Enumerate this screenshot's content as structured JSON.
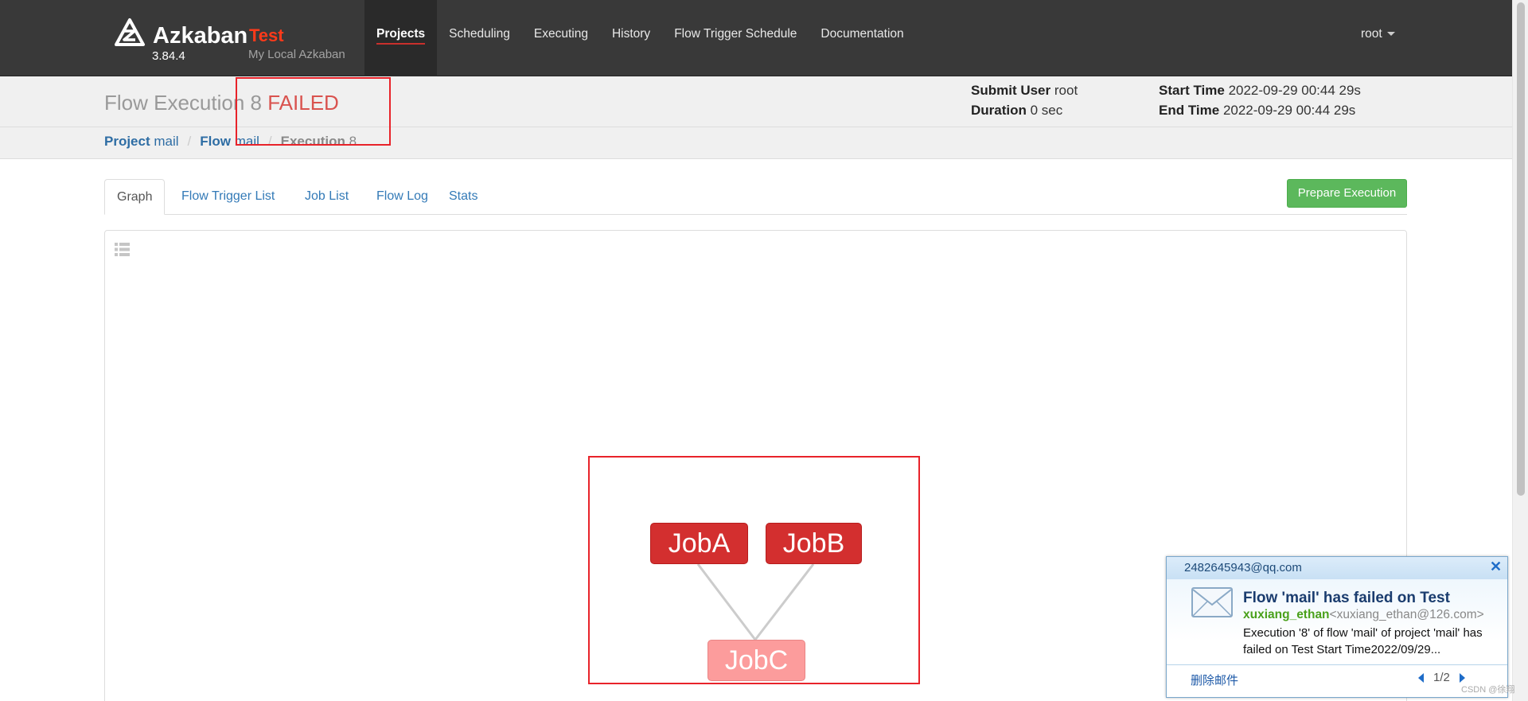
{
  "brand": {
    "name": "Azkaban",
    "version": "3.84.4",
    "environment": "Test",
    "subtitle": "My Local Azkaban"
  },
  "nav": {
    "items": [
      {
        "label": "Projects",
        "active": true
      },
      {
        "label": "Scheduling",
        "active": false
      },
      {
        "label": "Executing",
        "active": false
      },
      {
        "label": "History",
        "active": false
      },
      {
        "label": "Flow Trigger Schedule",
        "active": false
      },
      {
        "label": "Documentation",
        "active": false
      }
    ],
    "user": "root"
  },
  "header": {
    "title": "Flow Execution 8",
    "status": "FAILED",
    "submit_user_label": "Submit User",
    "submit_user": "root",
    "duration_label": "Duration",
    "duration": "0 sec",
    "start_time_label": "Start Time",
    "start_time": "2022-09-29 00:44 29s",
    "end_time_label": "End Time",
    "end_time": "2022-09-29 00:44 29s"
  },
  "breadcrumb": {
    "project_label": "Project",
    "project": "mail",
    "flow_label": "Flow",
    "flow": "mail",
    "execution_label": "Execution",
    "execution": "8"
  },
  "tabs": [
    {
      "label": "Graph",
      "active": true
    },
    {
      "label": "Flow Trigger List",
      "active": false
    },
    {
      "label": "Job List",
      "active": false
    },
    {
      "label": "Flow Log",
      "active": false
    },
    {
      "label": "Stats",
      "active": false
    }
  ],
  "prepare_button": "Prepare Execution",
  "graph": {
    "jobs": [
      {
        "name": "JobA",
        "status": "failed"
      },
      {
        "name": "JobB",
        "status": "failed"
      },
      {
        "name": "JobC",
        "status": "cancelled"
      }
    ],
    "edges": [
      [
        "JobA",
        "JobC"
      ],
      [
        "JobB",
        "JobC"
      ]
    ],
    "colors": {
      "failed": "#d32f2f",
      "cancelled": "#fc9c9c",
      "edge": "#cccccc",
      "highlight": "#e8232a"
    }
  },
  "mail_notification": {
    "account": "2482645943@qq.com",
    "subject": "Flow 'mail' has failed on Test",
    "sender_name": "xuxiang_ethan",
    "sender_address": "<xuxiang_ethan@126.com>",
    "body": "Execution '8' of flow 'mail' of project 'mail' has failed on Test  Start Time2022/09/29...",
    "delete_label": "删除邮件",
    "pager": "1/2"
  },
  "watermark": "CSDN @徐翔"
}
